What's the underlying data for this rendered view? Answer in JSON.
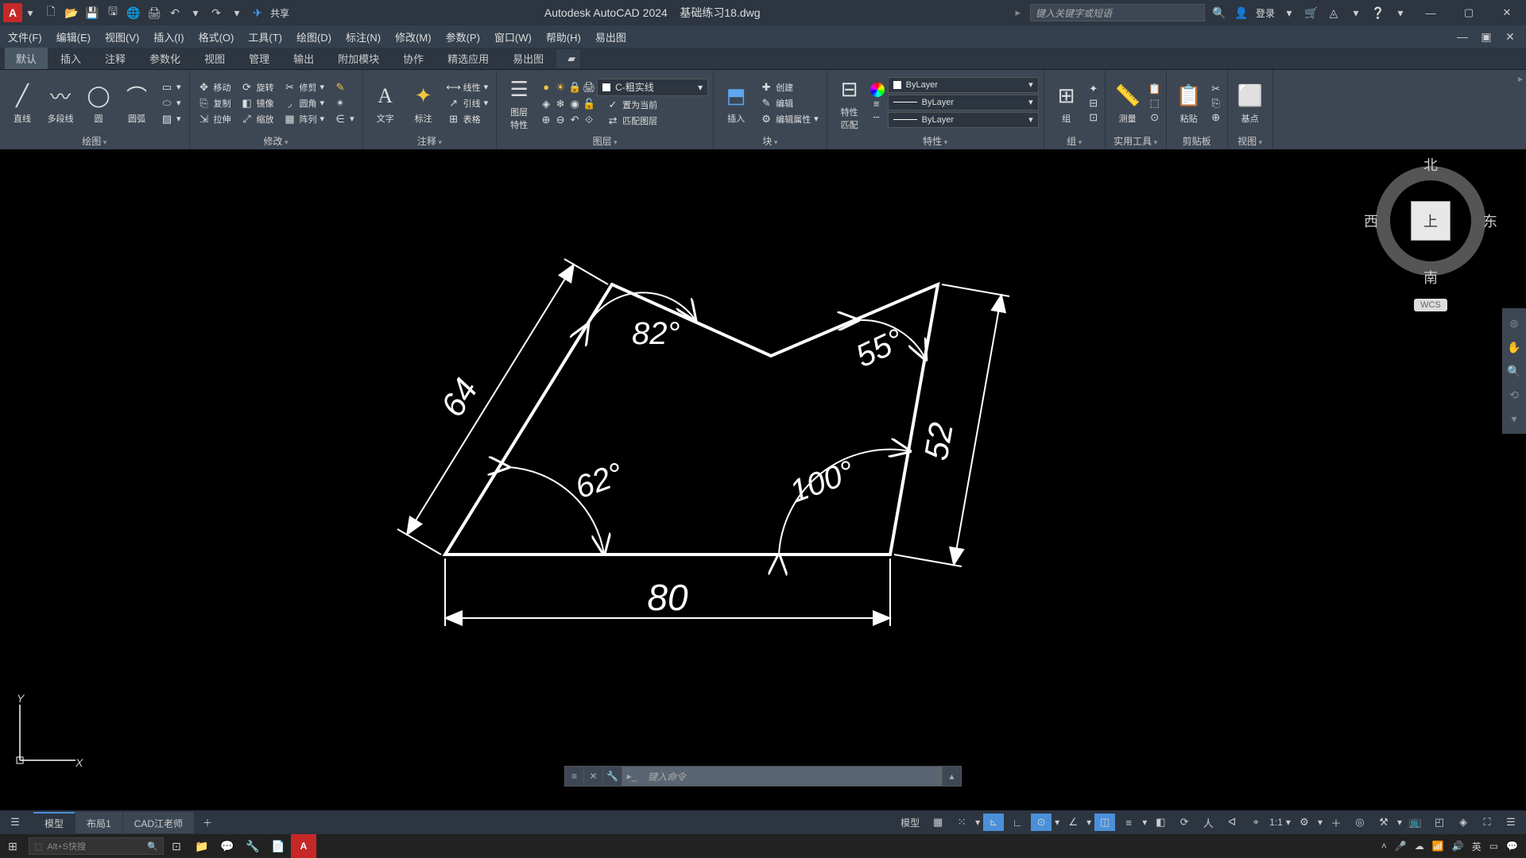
{
  "app": {
    "title_prefix": "Autodesk AutoCAD 2024",
    "filename": "基础练习18.dwg"
  },
  "qat": {
    "share": "共享"
  },
  "search": {
    "placeholder": "键入关键字或短语",
    "login": "登录"
  },
  "menubar": [
    "文件(F)",
    "编辑(E)",
    "视图(V)",
    "插入(I)",
    "格式(O)",
    "工具(T)",
    "绘图(D)",
    "标注(N)",
    "修改(M)",
    "参数(P)",
    "窗口(W)",
    "帮助(H)",
    "易出图"
  ],
  "tabs": [
    "默认",
    "插入",
    "注释",
    "参数化",
    "视图",
    "管理",
    "输出",
    "附加模块",
    "协作",
    "精选应用",
    "易出图"
  ],
  "ribbon": {
    "draw": {
      "title": "绘图",
      "items": [
        "直线",
        "多段线",
        "圆",
        "圆弧"
      ]
    },
    "modify": {
      "title": "修改",
      "items": {
        "move": "移动",
        "rotate": "旋转",
        "trim": "修剪",
        "copy": "复制",
        "mirror": "镜像",
        "fillet": "圆角",
        "stretch": "拉伸",
        "scale": "缩放",
        "array": "阵列"
      }
    },
    "annot": {
      "title": "注释",
      "items": {
        "text": "文字",
        "dim": "标注",
        "linear": "线性",
        "leader": "引线",
        "table": "表格"
      }
    },
    "layer": {
      "title": "图层",
      "props": "图层\n特性",
      "current": "C-粗实线",
      "setcur": "置为当前",
      "match": "匹配图层"
    },
    "block": {
      "title": "块",
      "insert": "插入",
      "create": "创建",
      "edit": "编辑",
      "editattr": "编辑属性"
    },
    "props": {
      "title": "特性",
      "match": "特性\n匹配",
      "bylayer": "ByLayer"
    },
    "group": {
      "title": "组",
      "label": "组"
    },
    "util": {
      "title": "实用工具",
      "label": "测量"
    },
    "clip": {
      "title": "剪贴板",
      "label": "粘贴"
    },
    "base": {
      "title": "视图",
      "label": "基点"
    }
  },
  "viewcube": {
    "n": "北",
    "s": "南",
    "e": "东",
    "w": "西",
    "top": "上",
    "wcs": "WCS"
  },
  "cmdline": {
    "placeholder": "键入命令"
  },
  "modeltabs": [
    "模型",
    "布局1",
    "CAD江老师"
  ],
  "statusbar": {
    "model": "模型",
    "scale": "1:1"
  },
  "drawing": {
    "dims": {
      "bottom": "80",
      "left": "64",
      "right": "52"
    },
    "angles": {
      "tl": "82°",
      "bl": "62°",
      "br": "100°",
      "tr": "55°"
    }
  },
  "ucs": {
    "x": "X",
    "y": "Y"
  },
  "taskbar_search": "Alt+S快搜"
}
